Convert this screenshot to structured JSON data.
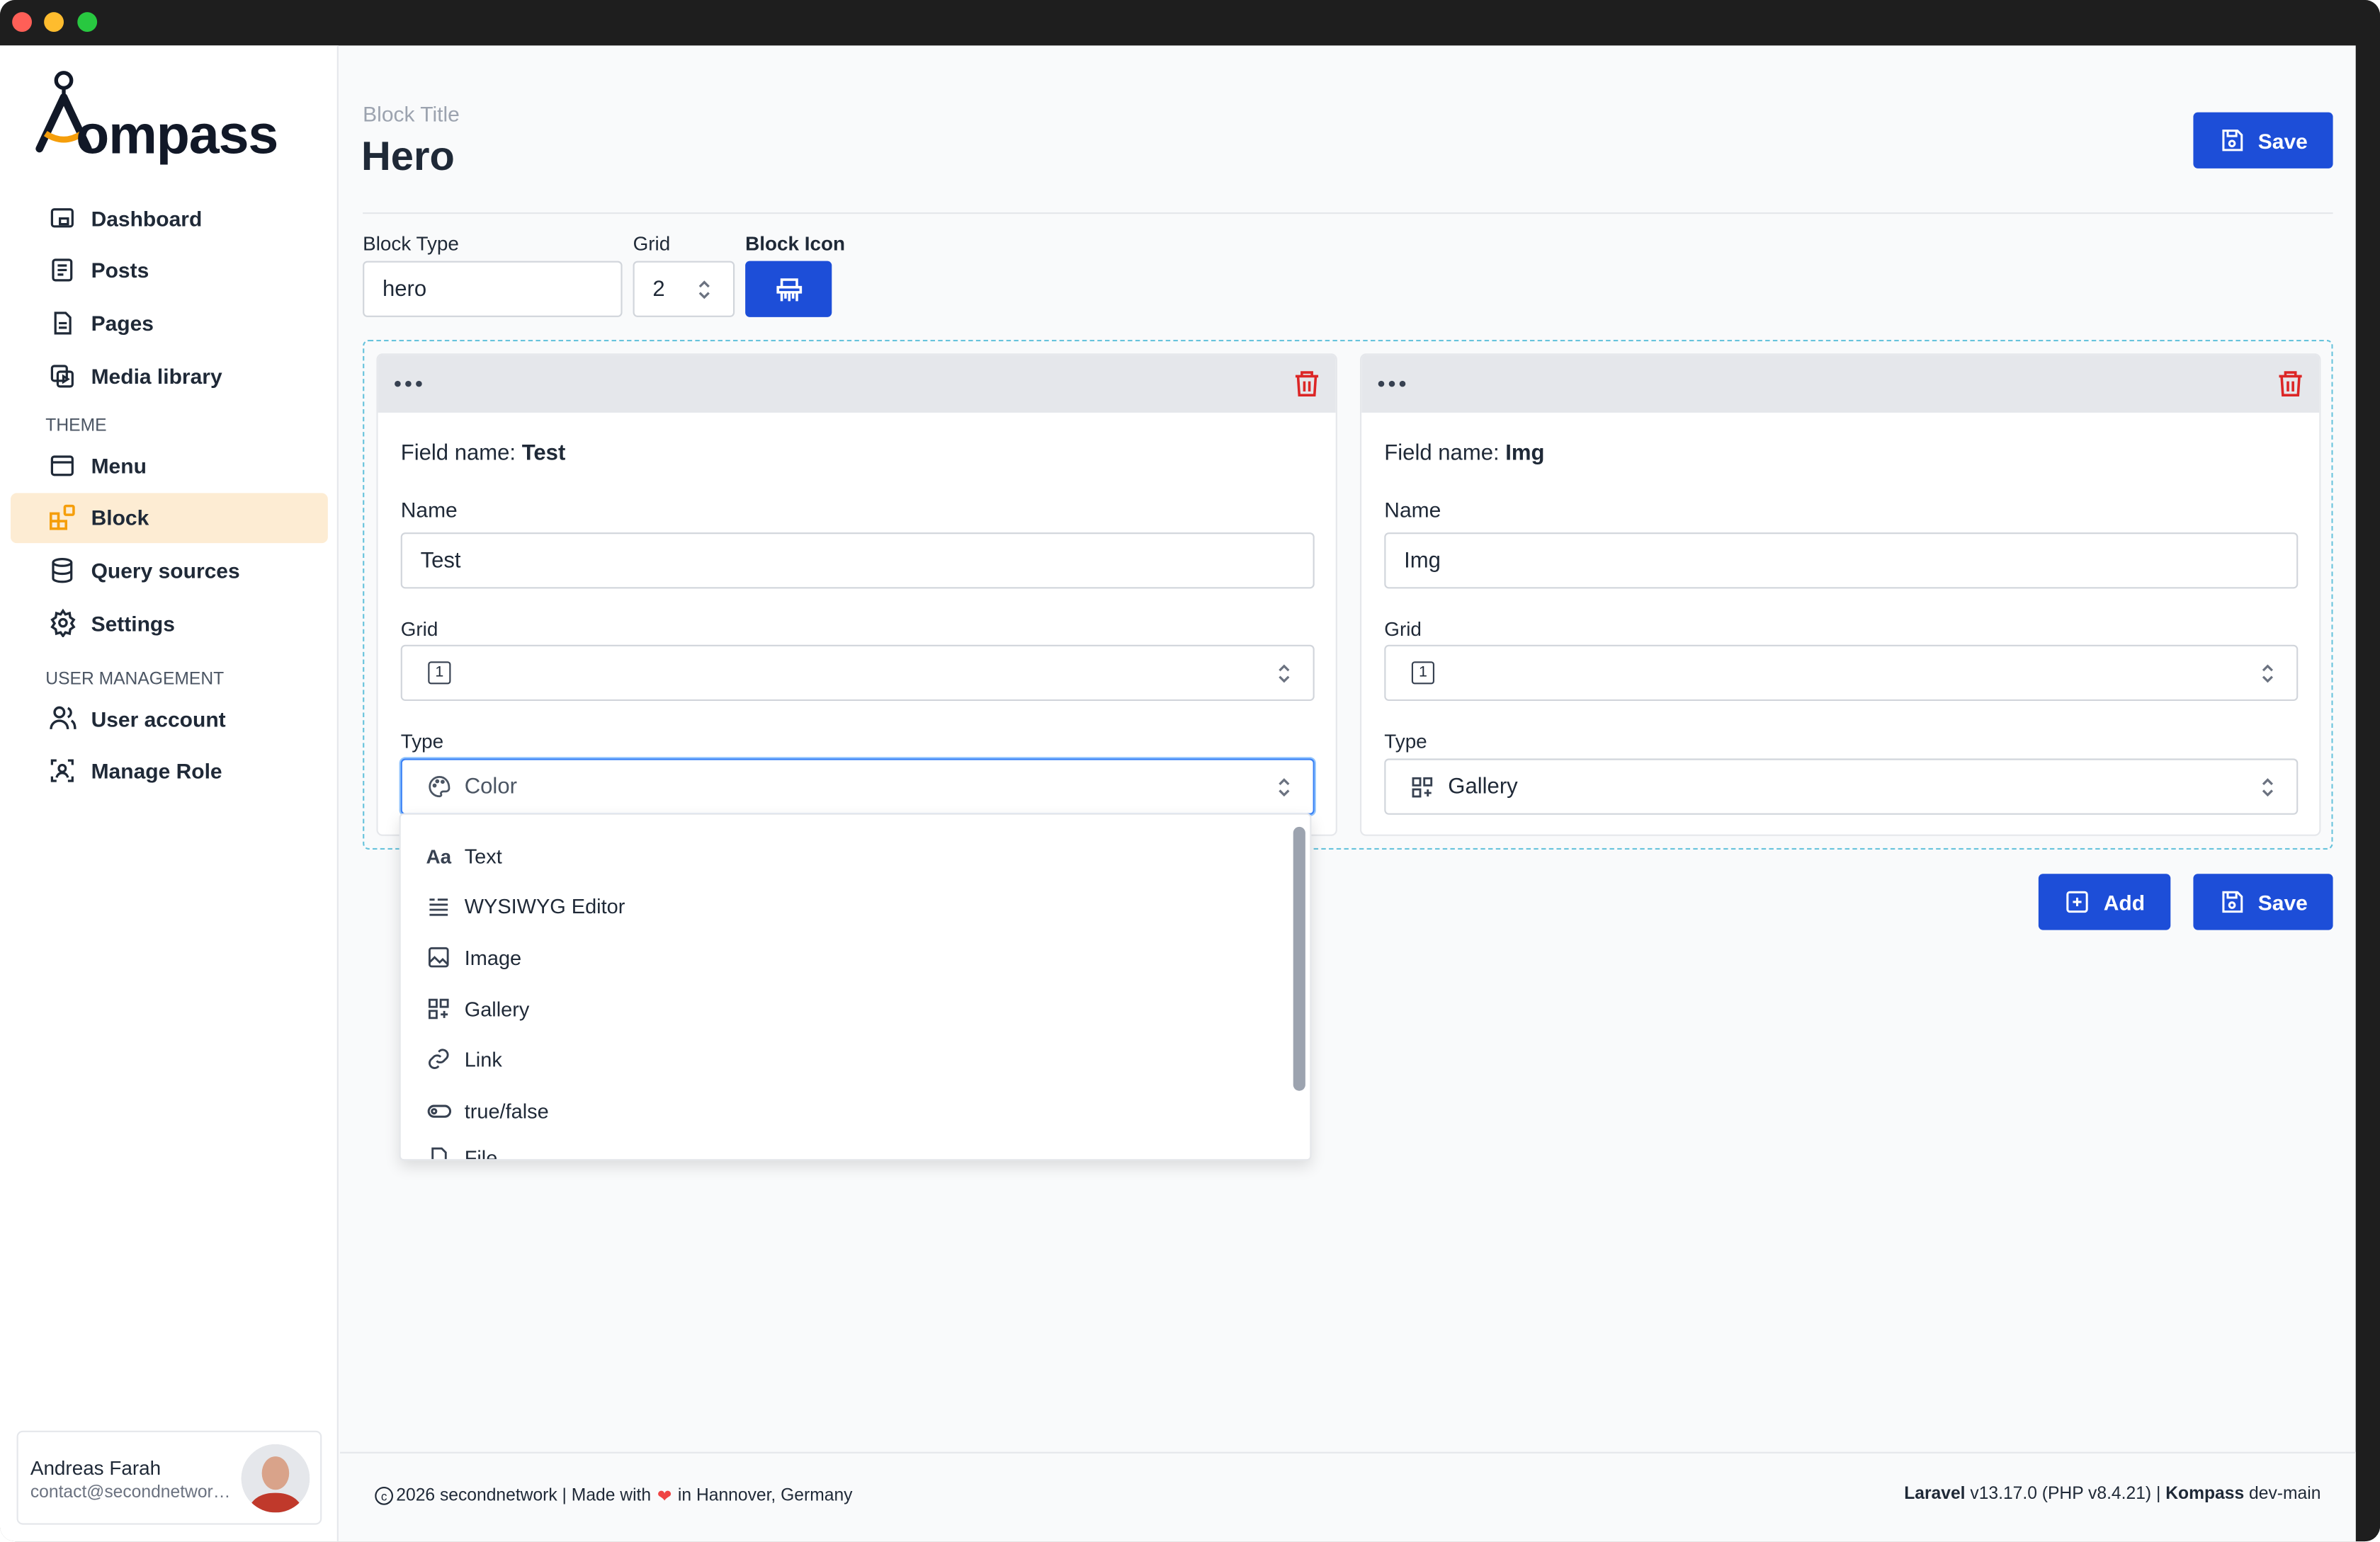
{
  "sidebar": {
    "logo": {
      "first_letter": "K",
      "rest": "ompass",
      "accent": "#f59e0b"
    },
    "items": [
      {
        "label": "Dashboard",
        "icon": "dashboard-icon"
      },
      {
        "label": "Posts",
        "icon": "posts-icon"
      },
      {
        "label": "Pages",
        "icon": "pages-icon"
      },
      {
        "label": "Media library",
        "icon": "media-library-icon"
      }
    ],
    "theme_heading": "THEME",
    "theme_items": [
      {
        "label": "Menu",
        "icon": "menu-icon"
      },
      {
        "label": "Block",
        "icon": "block-icon",
        "active": true
      },
      {
        "label": "Query sources",
        "icon": "database-icon"
      },
      {
        "label": "Settings",
        "icon": "gear-icon"
      }
    ],
    "user_heading": "USER MANAGEMENT",
    "user_items": [
      {
        "label": "User account",
        "icon": "users-icon"
      },
      {
        "label": "Manage Role",
        "icon": "role-icon"
      }
    ],
    "user": {
      "name": "Andreas Farah",
      "email": "contact@secondnetwork.de"
    }
  },
  "header": {
    "label": "Block Title",
    "title": "Hero",
    "save_label": "Save"
  },
  "settings": {
    "block_type_label": "Block Type",
    "block_type_value": "hero",
    "grid_label": "Grid",
    "grid_value": "2",
    "block_icon_label": "Block Icon"
  },
  "fields": [
    {
      "field_name_prefix": "Field name: ",
      "field_name": "Test",
      "name_label": "Name",
      "name_value": "Test",
      "grid_label": "Grid",
      "grid_value": "1",
      "type_label": "Type",
      "type_value": "Color"
    },
    {
      "field_name_prefix": "Field name: ",
      "field_name": "Img",
      "name_label": "Name",
      "name_value": "Img",
      "grid_label": "Grid",
      "grid_value": "1",
      "type_label": "Type",
      "type_value": "Gallery"
    }
  ],
  "type_options": [
    "Text",
    "WYSIWYG Editor",
    "Image",
    "Gallery",
    "Link",
    "true/false",
    "File"
  ],
  "actions": {
    "add_label": "Add",
    "save_label": "Save"
  },
  "footer": {
    "copyright": "2026 secondnetwork | Made with",
    "location": "in Hannover, Germany",
    "laravel_label": "Laravel",
    "laravel_version": "v13.17.0 (PHP v8.4.21) |",
    "kompass_label": "Kompass",
    "kompass_version": "dev-main"
  },
  "colors": {
    "primary": "#1d4ed8",
    "active_bg": "#fdecd3",
    "danger": "#dc2626"
  }
}
